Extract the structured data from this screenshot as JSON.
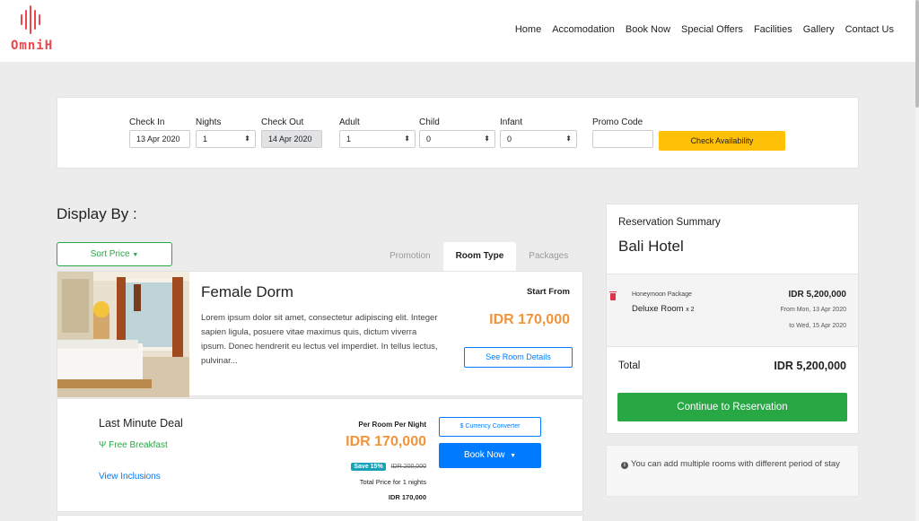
{
  "brand": {
    "logo_text": "OmniH",
    "color": "#e8474d"
  },
  "nav": [
    "Home",
    "Accomodation",
    "Book Now",
    "Special Offers",
    "Facilities",
    "Gallery",
    "Contact Us"
  ],
  "search": {
    "check_in": {
      "label": "Check In",
      "value": "13 Apr 2020"
    },
    "nights": {
      "label": "Nights",
      "value": "1"
    },
    "check_out": {
      "label": "Check Out",
      "value": "14 Apr 2020"
    },
    "adult": {
      "label": "Adult",
      "value": "1"
    },
    "child": {
      "label": "Child",
      "value": "0"
    },
    "infant": {
      "label": "Infant",
      "value": "0"
    },
    "promo": {
      "label": "Promo Code",
      "value": ""
    },
    "submit": "Check Availability"
  },
  "display_by": "Display By :",
  "sort_button": "Sort Price",
  "tabs": [
    {
      "label": "Promotion",
      "active": false
    },
    {
      "label": "Room Type",
      "active": true
    },
    {
      "label": "Packages",
      "active": false
    }
  ],
  "room": {
    "name": "Female Dorm",
    "description": "Lorem ipsum dolor sit amet, consectetur adipiscing elit. Integer sapien ligula, posuere vitae maximus quis, dictum viverra ipsum. Donec hendrerit eu lectus vel imperdiet. In tellus lectus, pulvinar...",
    "start_from_label": "Start From",
    "price": "IDR 170,000",
    "details_button": "See Room Details"
  },
  "deal": {
    "name": "Last Minute Deal",
    "breakfast": "Free Breakfast",
    "inclusions_link": "View Inclusions",
    "per_room_label": "Per Room Per Night",
    "price": "IDR 170,000",
    "save_badge": "Save 15%",
    "original_price": "IDR 200,000",
    "total_for": "Total Price for 1 nights",
    "total_price": "IDR 170,000",
    "currency_button": "$ Currency Converter",
    "book_button": "Book Now"
  },
  "summary": {
    "heading": "Reservation Summary",
    "hotel": "Bali Hotel",
    "package": "Honeymoon Package",
    "room_type": "Deluxe Room",
    "qty": "x 2",
    "amount": "IDR 5,200,000",
    "from": "From Mon, 13 Apr 2020",
    "to": "to Wed, 15 Apr 2020",
    "total_label": "Total",
    "total_amount": "IDR 5,200,000",
    "continue_button": "Continue to Reservation"
  },
  "info": "You can add multiple rooms with different period of stay",
  "colors": {
    "accent_orange": "#f0953b",
    "primary_blue": "#007bff",
    "success_green": "#28a745",
    "warning_yellow": "#ffc107",
    "danger_red": "#dc3545",
    "info_teal": "#17a2b8"
  }
}
